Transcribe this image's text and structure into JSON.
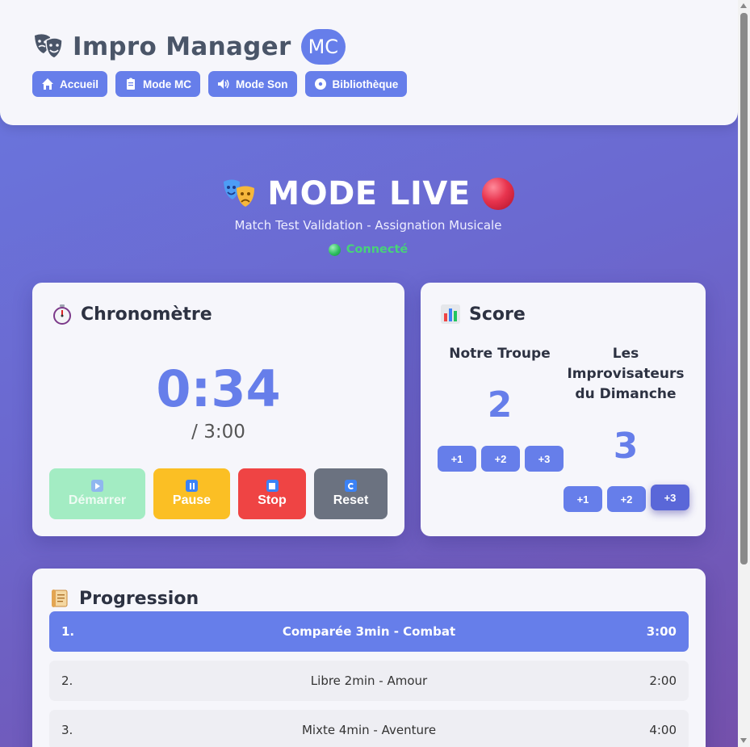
{
  "header": {
    "title": "Impro Manager",
    "badge": "MC",
    "nav": [
      {
        "label": "Accueil",
        "icon": "home-icon"
      },
      {
        "label": "Mode MC",
        "icon": "clipboard-icon"
      },
      {
        "label": "Mode Son",
        "icon": "speaker-icon"
      },
      {
        "label": "Bibliothèque",
        "icon": "disc-icon"
      }
    ]
  },
  "live": {
    "title": "MODE LIVE",
    "subtitle": "Match Test Validation - Assignation Musicale",
    "status": "Connecté",
    "status_color": "#48d17a"
  },
  "chrono": {
    "title": "Chronomètre",
    "elapsed": "0:34",
    "total": "/ 3:00",
    "buttons": {
      "start": "Démarrer",
      "pause": "Pause",
      "stop": "Stop",
      "reset": "Reset"
    }
  },
  "score": {
    "title": "Score",
    "team_a": {
      "name": "Notre Troupe",
      "score": "2"
    },
    "team_b": {
      "name": "Les Improvisateurs du Dimanche",
      "score": "3"
    },
    "points": [
      "+1",
      "+2",
      "+3"
    ]
  },
  "progression": {
    "title": "Progression",
    "items": [
      {
        "num": "1.",
        "name": "Comparée 3min - Combat",
        "duration": "3:00",
        "current": true
      },
      {
        "num": "2.",
        "name": "Libre 2min - Amour",
        "duration": "2:00",
        "current": false
      },
      {
        "num": "3.",
        "name": "Mixte 4min - Aventure",
        "duration": "4:00",
        "current": false
      }
    ]
  },
  "colors": {
    "accent": "#667eea",
    "pause": "#fbbf24",
    "stop": "#ef4444",
    "reset": "#6b7280",
    "start_disabled": "#a3ecc3"
  }
}
